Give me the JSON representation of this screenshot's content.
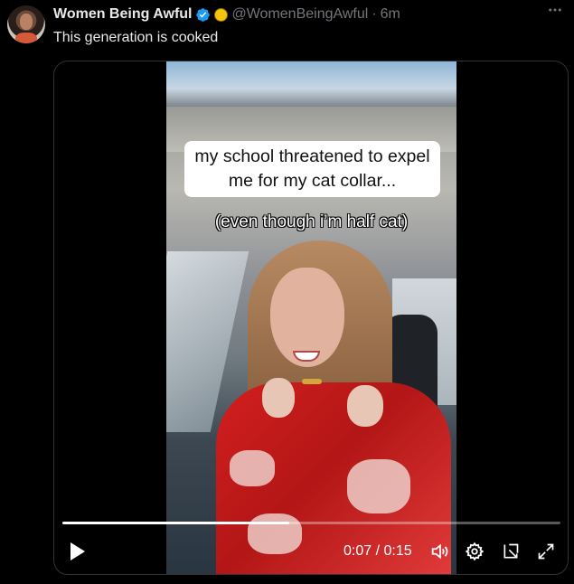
{
  "tweet": {
    "display_name": "Women Being Awful",
    "handle": "@WomenBeingAwful",
    "separator": "·",
    "time": "6m",
    "text": "This generation is cooked",
    "more_icon": "more-horizontal-icon",
    "verified_icon": "verified-badge-icon",
    "affiliate_icon": "affiliate-badge-icon"
  },
  "video": {
    "caption_main": "my school threatened to expel me for my cat collar...",
    "caption_sub": "(even though i’m half cat)",
    "current_time": "0:07",
    "time_separator": " / ",
    "duration": "0:15",
    "progress": 0.455,
    "controls": {
      "play_icon": "play-icon",
      "volume_icon": "volume-icon",
      "settings_icon": "settings-gear-icon",
      "popout_icon": "popout-icon",
      "fullscreen_icon": "fullscreen-icon"
    }
  },
  "colors": {
    "background": "#000000",
    "text_primary": "#e7e9ea",
    "text_secondary": "#71767b",
    "verified_blue": "#1d9bf0",
    "affiliate_gold": "#f4c40f",
    "border": "#2f3336"
  }
}
